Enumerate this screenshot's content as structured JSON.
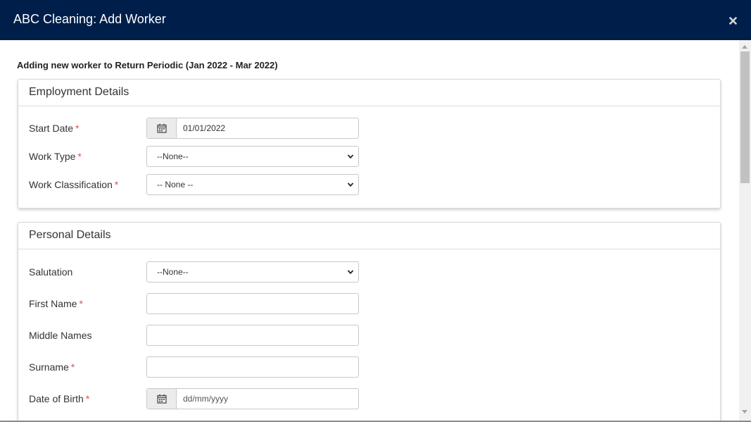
{
  "modal": {
    "title": "ABC Cleaning: Add Worker",
    "close_icon": "close-icon",
    "header_color": "#001e4a"
  },
  "intro_text": "Adding new worker to Return Periodic (Jan 2022 - Mar 2022)",
  "required_marker": "*",
  "employment": {
    "heading": "Employment Details",
    "start_date": {
      "label": "Start Date",
      "value": "01/01/2022",
      "icon": "calendar-icon"
    },
    "work_type": {
      "label": "Work Type",
      "value": "--None--"
    },
    "work_classification": {
      "label": "Work Classification",
      "value": "-- None --"
    }
  },
  "personal": {
    "heading": "Personal Details",
    "salutation": {
      "label": "Salutation",
      "value": "--None--"
    },
    "first_name": {
      "label": "First Name",
      "value": ""
    },
    "middle_names": {
      "label": "Middle Names",
      "value": ""
    },
    "surname": {
      "label": "Surname",
      "value": ""
    },
    "date_of_birth": {
      "label": "Date of Birth",
      "placeholder": "dd/mm/yyyy",
      "icon": "calendar-icon"
    }
  }
}
